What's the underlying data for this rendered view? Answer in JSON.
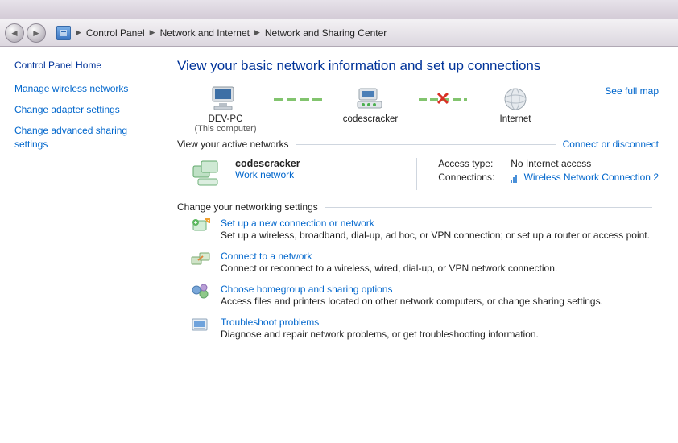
{
  "breadcrumb": {
    "items": [
      "Control Panel",
      "Network and Internet",
      "Network and Sharing Center"
    ]
  },
  "sidebar": {
    "home": "Control Panel Home",
    "links": {
      "wireless": "Manage wireless networks",
      "adapter": "Change adapter settings",
      "advanced": "Change advanced sharing settings"
    }
  },
  "main": {
    "heading": "View your basic network information and set up connections",
    "see_full_map": "See full map",
    "map": {
      "node1_label": "DEV-PC",
      "node1_sub": "(This computer)",
      "node2_label": "codescracker",
      "node3_label": "Internet"
    },
    "active_hdr": "View your active networks",
    "connect_link": "Connect or disconnect",
    "active_network": {
      "name": "codescracker",
      "type": "Work network",
      "access_label": "Access type:",
      "access_value": "No Internet access",
      "conn_label": "Connections:",
      "conn_value": "Wireless Network Connection 2"
    },
    "settings_hdr": "Change your networking settings",
    "tasks": {
      "t1_link": "Set up a new connection or network",
      "t1_desc": "Set up a wireless, broadband, dial-up, ad hoc, or VPN connection; or set up a router or access point.",
      "t2_link": "Connect to a network",
      "t2_desc": "Connect or reconnect to a wireless, wired, dial-up, or VPN network connection.",
      "t3_link": "Choose homegroup and sharing options",
      "t3_desc": "Access files and printers located on other network computers, or change sharing settings.",
      "t4_link": "Troubleshoot problems",
      "t4_desc": "Diagnose and repair network problems, or get troubleshooting information."
    }
  }
}
